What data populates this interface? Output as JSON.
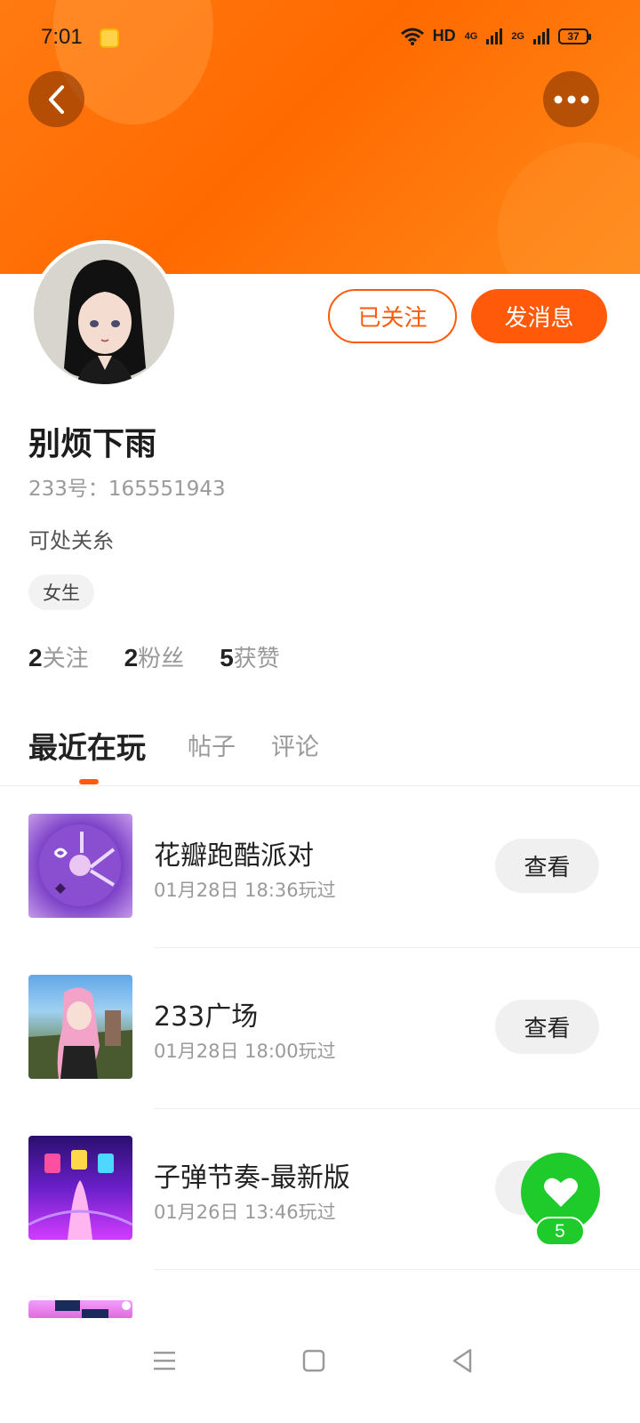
{
  "status_bar": {
    "time": "7:01",
    "network": "HD",
    "signal1": "4G",
    "signal2": "2G",
    "battery": "37"
  },
  "profile": {
    "username": "别烦下雨",
    "user_id": "233号：165551943",
    "bio": "可处关糸",
    "gender_tag": "女生",
    "following_label": "已关注",
    "message_label": "发消息",
    "stats": [
      {
        "num": "2",
        "label": "关注"
      },
      {
        "num": "2",
        "label": "粉丝"
      },
      {
        "num": "5",
        "label": "获赞"
      }
    ]
  },
  "tabs": {
    "recent": "最近在玩",
    "posts": "帖子",
    "comments": "评论"
  },
  "games": [
    {
      "title": "花瓣跑酷派对",
      "time": "01月28日 18:36玩过",
      "action": "查看"
    },
    {
      "title": "233广场",
      "time": "01月28日 18:00玩过",
      "action": "查看"
    },
    {
      "title": "子弹节奏-最新版",
      "time": "01月26日 13:46玩过",
      "action": "查看"
    }
  ],
  "like_fab": {
    "count": "5",
    "color": "#1ecb2a"
  },
  "colors": {
    "accent": "#ff5a0a",
    "banner": "#ff6a00"
  },
  "icons": [
    "back-arrow-icon",
    "more-dots-icon",
    "heart-icon",
    "menu-icon",
    "home-square-icon",
    "back-triangle-icon"
  ]
}
